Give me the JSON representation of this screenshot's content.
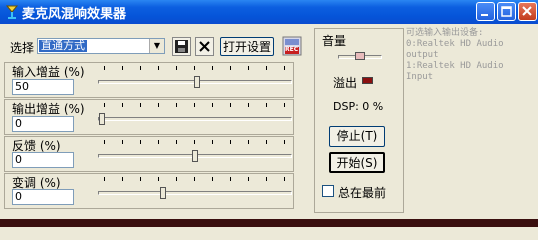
{
  "window": {
    "title": "麦克风混响效果器"
  },
  "toolbar": {
    "select_label": "选择",
    "mode_value": "直通方式",
    "setup_label": "打开设置",
    "rec_label": "REC"
  },
  "controls": {
    "input_gain": {
      "label": "输入增益 (%)",
      "value": "50",
      "level": 0.5
    },
    "output_gain": {
      "label": "输出增益 (%)",
      "value": "0",
      "level": 0.0
    },
    "feedback": {
      "label": "反馈 (%)",
      "value": "0",
      "level": 0.5
    },
    "pitch": {
      "label": "变调 (%)",
      "value": "0",
      "level": 0.34
    }
  },
  "mid": {
    "volume_label": "音量",
    "overflow_label": "溢出",
    "dsp_label": "DSP: 0 %",
    "stop_label": "停止(T)",
    "start_label": "开始(S)",
    "always_on_top_label": "总在最前"
  },
  "devices": {
    "header": "可选输入输出设备:",
    "lines": [
      "0:Realtek HD Audio",
      "output",
      "1:Realtek HD Audio",
      "Input"
    ]
  },
  "colors": {
    "title_bar": "#0554d8",
    "selection": "#316ac5",
    "led": "#8a1010"
  }
}
